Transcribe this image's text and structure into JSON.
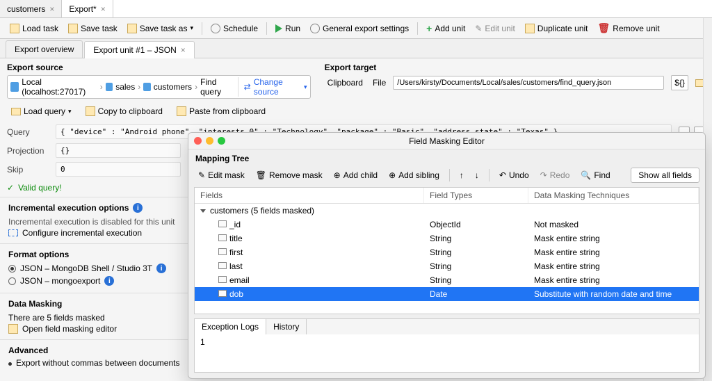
{
  "top_tabs": {
    "t0": "customers",
    "t1": "Export*"
  },
  "toolbar": {
    "load": "Load task",
    "save": "Save task",
    "saveas": "Save task as",
    "schedule": "Schedule",
    "run": "Run",
    "settings": "General export settings",
    "addunit": "Add unit",
    "editunit": "Edit unit",
    "dupunit": "Duplicate unit",
    "remunit": "Remove unit"
  },
  "sub_tabs": {
    "overview": "Export overview",
    "unit": "Export unit #1 – JSON"
  },
  "source": {
    "title": "Export source",
    "conn": "Local (localhost:27017)",
    "db": "sales",
    "coll": "customers",
    "find": "Find query",
    "change": "Change source"
  },
  "target": {
    "title": "Export target",
    "clipboard": "Clipboard",
    "file": "File",
    "path": "/Users/kirsty/Documents/Local/sales/customers/find_query.json",
    "fmt": "${}"
  },
  "loadrow": {
    "load": "Load query",
    "copy": "Copy to clipboard",
    "paste": "Paste from clipboard"
  },
  "query": {
    "label_q": "Query",
    "label_p": "Projection",
    "label_s": "Skip",
    "q": "{ \"device\" : \"Android phone\", \"interests.0\" : \"Technology\", \"package\" : \"Basic\", \"address.state\" : \"Texas\" }",
    "p": "{}",
    "s": "0"
  },
  "valid": "Valid query!",
  "inc": {
    "title": "Incremental execution options",
    "disabled": "Incremental execution is disabled for this unit",
    "cfg": "Configure incremental execution"
  },
  "fmt": {
    "title": "Format options",
    "r1": "JSON – MongoDB Shell / Studio 3T",
    "r2": "JSON – mongoexport"
  },
  "mask": {
    "title": "Data Masking",
    "line": "There are 5 fields masked",
    "open": "Open field masking editor"
  },
  "adv": {
    "title": "Advanced",
    "opt1": "Export without commas between documents"
  },
  "modal": {
    "title": "Field Masking Editor",
    "tree": "Mapping Tree",
    "tb": {
      "edit": "Edit mask",
      "remove": "Remove mask",
      "addchild": "Add child",
      "addsib": "Add sibling",
      "undo": "Undo",
      "redo": "Redo",
      "find": "Find",
      "showall": "Show all fields"
    },
    "hdr": {
      "f": "Fields",
      "t": "Field Types",
      "m": "Data Masking Techniques"
    },
    "group": "customers (5 fields masked)",
    "rows": [
      {
        "f": "_id",
        "t": "ObjectId",
        "m": "Not masked"
      },
      {
        "f": "title",
        "t": "String",
        "m": "Mask entire string"
      },
      {
        "f": "first",
        "t": "String",
        "m": "Mask entire string"
      },
      {
        "f": "last",
        "t": "String",
        "m": "Mask entire string"
      },
      {
        "f": "email",
        "t": "String",
        "m": "Mask entire string"
      },
      {
        "f": "dob",
        "t": "Date",
        "m": "Substitute with random date and time"
      }
    ],
    "logs": {
      "t1": "Exception Logs",
      "t2": "History",
      "content": "1"
    }
  }
}
